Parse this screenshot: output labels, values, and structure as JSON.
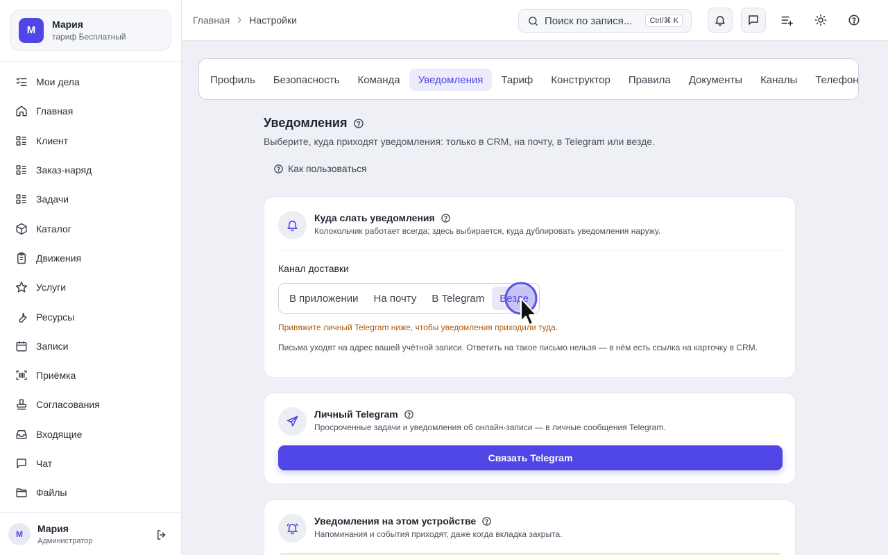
{
  "org": {
    "avatar": "М",
    "name": "Мария",
    "plan": "тариф Бесплатный"
  },
  "nav": [
    {
      "id": "todo",
      "label": "Мои дела",
      "icon": "checklist-icon"
    },
    {
      "id": "home",
      "label": "Главная",
      "icon": "home-icon"
    },
    {
      "id": "client",
      "label": "Клиент",
      "icon": "list-icon"
    },
    {
      "id": "order",
      "label": "Заказ-наряд",
      "icon": "list-icon"
    },
    {
      "id": "tasks",
      "label": "Задачи",
      "icon": "list-icon"
    },
    {
      "id": "catalog",
      "label": "Каталог",
      "icon": "box-icon"
    },
    {
      "id": "movements",
      "label": "Движения",
      "icon": "clipboard-icon"
    },
    {
      "id": "services",
      "label": "Услуги",
      "icon": "star-icon"
    },
    {
      "id": "resources",
      "label": "Ресурсы",
      "icon": "wrench-icon"
    },
    {
      "id": "appointments",
      "label": "Записи",
      "icon": "calendar-icon"
    },
    {
      "id": "intake",
      "label": "Приёмка",
      "icon": "scan-icon"
    },
    {
      "id": "approvals",
      "label": "Согласования",
      "icon": "stamp-icon"
    },
    {
      "id": "inbox",
      "label": "Входящие",
      "icon": "inbox-icon"
    },
    {
      "id": "chat",
      "label": "Чат",
      "icon": "chat-icon"
    },
    {
      "id": "files",
      "label": "Файлы",
      "icon": "folder-icon"
    }
  ],
  "user": {
    "avatar": "М",
    "name": "Мария",
    "role": "Администратор"
  },
  "breadcrumb": {
    "home": "Главная",
    "current": "Настройки"
  },
  "search": {
    "placeholder": "Поиск по запися...",
    "shortcut": "Ctrl/⌘ K"
  },
  "tabs": [
    {
      "label": "Профиль",
      "active": false
    },
    {
      "label": "Безопасность",
      "active": false
    },
    {
      "label": "Команда",
      "active": false
    },
    {
      "label": "Уведомления",
      "active": true
    },
    {
      "label": "Тариф",
      "active": false
    },
    {
      "label": "Конструктор",
      "active": false
    },
    {
      "label": "Правила",
      "active": false
    },
    {
      "label": "Документы",
      "active": false
    },
    {
      "label": "Каналы",
      "active": false
    },
    {
      "label": "Телефония",
      "active": false
    }
  ],
  "page": {
    "title": "Уведомления",
    "subtitle": "Выберите, куда приходят уведомления: только в CRM, на почту, в Telegram или везде.",
    "howto": "Как пользоваться"
  },
  "delivery_card": {
    "title": "Куда слать уведомления",
    "desc": "Колокольчик работает всегда; здесь выбирается, куда дублировать уведомления наружу.",
    "field_label": "Канал доставки",
    "options": [
      "В приложении",
      "На почту",
      "В Telegram",
      "Везде"
    ],
    "selected": "Везде",
    "warning": "Привяжите личный Telegram ниже, чтобы уведомления приходили туда.",
    "note": "Письма уходят на адрес вашей учётной записи. Ответить на такое письмо нельзя — в нём есть ссылка на карточку в CRM."
  },
  "telegram_card": {
    "title": "Личный Telegram",
    "desc": "Просроченные задачи и уведомления об онлайн-записи — в личные сообщения Telegram.",
    "button": "Связать Telegram"
  },
  "device_card": {
    "title": "Уведомления на этом устройстве",
    "desc": "Напоминания и события приходят, даже когда вкладка закрыта."
  },
  "colors": {
    "accent": "#4f46e5",
    "warning": "#b05a0e",
    "background": "#eef0f5"
  }
}
